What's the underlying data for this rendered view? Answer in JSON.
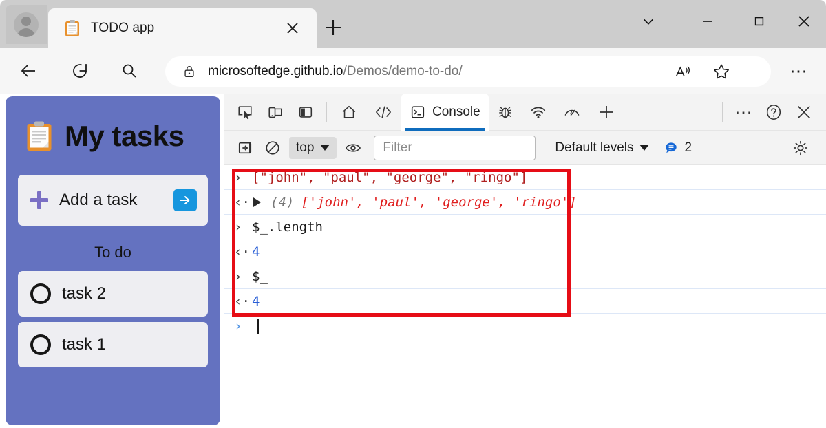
{
  "browser": {
    "tab": {
      "title": "TODO app",
      "favicon_icon": "clipboard-icon",
      "close_icon": "close-icon"
    },
    "newtab_icon": "plus-icon",
    "profile_icon": "account-avatar-icon",
    "window_controls": {
      "tab_search_icon": "chevron-down-icon",
      "minimize_icon": "minimize-icon",
      "maximize_icon": "maximize-icon",
      "close_icon": "close-icon"
    },
    "toolbar": {
      "back_icon": "back-arrow-icon",
      "reload_icon": "reload-icon",
      "search_icon": "search-icon",
      "more_label": "⋯",
      "read_aloud_icon": "read-aloud-icon",
      "favorite_icon": "star-icon"
    },
    "address": {
      "lock_icon": "lock-icon",
      "domain": "microsoftedge.github.io",
      "path": "/Demos/demo-to-do/"
    }
  },
  "todo_app": {
    "title": "My tasks",
    "title_icon": "clipboard-icon",
    "add_task": {
      "placeholder": "Add a task",
      "plus_icon": "plus-icon",
      "submit_icon": "arrow-right-icon"
    },
    "section_title": "To do",
    "tasks": [
      {
        "label": "task 2",
        "checkbox_icon": "circle-unchecked-icon"
      },
      {
        "label": "task 1",
        "checkbox_icon": "circle-unchecked-icon"
      }
    ],
    "accent_color": "#6472c0"
  },
  "devtools": {
    "left_buttons": [
      {
        "name": "inspect-element-icon",
        "title": "Inspect"
      },
      {
        "name": "device-emulation-icon",
        "title": "Device emulation"
      },
      {
        "name": "dock-side-icon",
        "title": "Dock side"
      }
    ],
    "tabs": [
      {
        "label": "",
        "icon": "home-icon",
        "active": false
      },
      {
        "label": "",
        "icon": "elements-icon",
        "active": false
      },
      {
        "label": "Console",
        "icon": "console-icon",
        "active": true
      },
      {
        "label": "",
        "icon": "bug-icon",
        "active": false
      },
      {
        "label": "",
        "icon": "network-icon",
        "active": false
      },
      {
        "label": "",
        "icon": "performance-icon",
        "active": false
      },
      {
        "label": "",
        "icon": "plus-icon",
        "active": false
      }
    ],
    "right_buttons": [
      {
        "name": "more-tools-icon",
        "label": "⋯"
      },
      {
        "name": "help-icon",
        "label": "?"
      },
      {
        "name": "close-devtools-icon",
        "label": "×"
      }
    ],
    "active_tab_accent": "#0f6cbd",
    "console_toolbar": {
      "sidebar_icon": "console-sidebar-icon",
      "clear_icon": "clear-console-icon",
      "context_label": "top",
      "eye_icon": "live-expression-icon",
      "filter_placeholder": "Filter",
      "levels_label": "Default levels",
      "message_icon": "message-bubble-icon",
      "message_count": "2",
      "settings_icon": "gear-icon"
    },
    "console_log": [
      {
        "kind": "input",
        "marker": "›",
        "text": "[\"john\", \"paul\", \"george\", \"ringo\"]"
      },
      {
        "kind": "output",
        "marker": "‹·",
        "expandable": true,
        "count": "(4)",
        "text": "['john', 'paul', 'george', 'ringo']"
      },
      {
        "kind": "input",
        "marker": "›",
        "text": "$_.length"
      },
      {
        "kind": "output",
        "marker": "‹·",
        "text": "4"
      },
      {
        "kind": "input",
        "marker": "›",
        "text": "$_"
      },
      {
        "kind": "output",
        "marker": "‹·",
        "text": "4"
      },
      {
        "kind": "prompt",
        "marker": "›",
        "text": ""
      }
    ],
    "annotation": {
      "type": "highlight-box",
      "color": "#e60d16"
    }
  }
}
